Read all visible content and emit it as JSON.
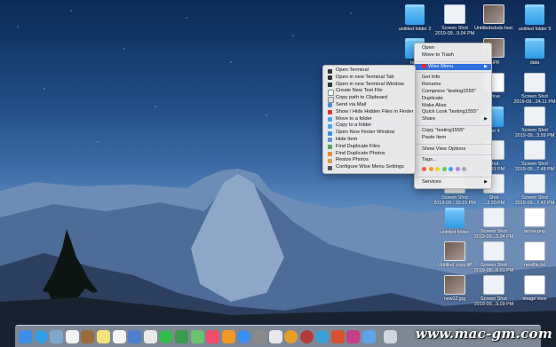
{
  "desktop_icons": [
    {
      "label": "untitled folder 2",
      "kind": "folder"
    },
    {
      "label": "Screen Shot\n2019-09...9.04 PM",
      "kind": "shot"
    },
    {
      "label": "Untitledsdsds.heic",
      "kind": "img"
    },
    {
      "label": "untitled folder 5",
      "kind": "folder"
    },
    {
      "label": "testi",
      "kind": "folder"
    },
    {
      "label": "d.jpg",
      "kind": "img"
    },
    {
      "label": "data",
      "kind": "folder"
    },
    {
      "label": "rchive",
      "kind": "doc"
    },
    {
      "label": "Screen Shot\n2019-09...24.11 PM",
      "kind": "shot"
    },
    {
      "label": "lder 4",
      "kind": "folder"
    },
    {
      "label": "Screen Shot\n2019-09...3.59 PM",
      "kind": "shot"
    },
    {
      "label": "Shot\n...3.31 PM",
      "kind": "shot"
    },
    {
      "label": "Screen Shot\n2019-09...7.48 PM",
      "kind": "shot"
    },
    {
      "label": "Screen Shot\n2019-09...10.15 PM",
      "kind": "shot"
    },
    {
      "label": "Shot\n...3.20 PM",
      "kind": "shot"
    },
    {
      "label": "Screen Shot\n2019-09...7.42 PM",
      "kind": "shot"
    },
    {
      "label": "untitled folder",
      "kind": "folder"
    },
    {
      "label": "Screen Shot\n2019-09...3.04 PM",
      "kind": "shot"
    },
    {
      "label": "arrow.png",
      "kind": "doc"
    },
    {
      "label": "Untitled copy.tiff",
      "kind": "img"
    },
    {
      "label": "Screen Shot\n2019-09...8.01 PM",
      "kind": "shot"
    },
    {
      "label": "newfile.txt",
      "kind": "doc"
    },
    {
      "label": "new12.jpg",
      "kind": "img"
    },
    {
      "label": "Screen Shot\n2019-09...9.09 PM",
      "kind": "shot"
    },
    {
      "label": "image view",
      "kind": "doc"
    }
  ],
  "main_menu": {
    "top": [
      {
        "label": "Open"
      },
      {
        "label": "Move to Trash"
      }
    ],
    "wise_menu": {
      "label": "Wise Menu"
    },
    "group2": [
      {
        "label": "Get Info"
      },
      {
        "label": "Rename"
      },
      {
        "label": "Compress \"testing1555\""
      },
      {
        "label": "Duplicate"
      },
      {
        "label": "Make Alias"
      },
      {
        "label": "Quick Look \"testing1555\""
      },
      {
        "label": "Share"
      }
    ],
    "group3": [
      {
        "label": "Copy \"testing1555\""
      },
      {
        "label": "Paste Item"
      }
    ],
    "group4": [
      {
        "label": "Show View Options"
      }
    ],
    "tags_label": "Tags...",
    "tag_colors": [
      "#ef5a4a",
      "#f49a34",
      "#f2d232",
      "#5cc85a",
      "#39a4f0",
      "#b07fe0",
      "#a9a9a9"
    ],
    "services": {
      "label": "Services"
    }
  },
  "wise_submenu": [
    {
      "label": "Open Terminal",
      "icon": "terminal-icon",
      "color": "#333"
    },
    {
      "label": "Open in new Terminal Tab",
      "icon": "terminal-icon",
      "color": "#333"
    },
    {
      "label": "Open in new Terminal Window",
      "icon": "terminal-icon",
      "color": "#333"
    },
    {
      "label": "Create New Text File",
      "icon": "document-icon",
      "color": "#fff"
    },
    {
      "label": "Copy path to Clipboard",
      "icon": "clipboard-icon",
      "color": "#ddd"
    },
    {
      "label": "Send via Mail",
      "icon": "mail-icon",
      "color": "#4a90e2"
    },
    {
      "label": "Show / Hide Hidden Files in Finder",
      "icon": "eye-icon",
      "color": "#d33"
    },
    {
      "label": "Move to a folder",
      "icon": "folder-icon",
      "color": "#4aa8f0"
    },
    {
      "label": "Copy to a folder",
      "icon": "folder-icon",
      "color": "#4aa8f0"
    },
    {
      "label": "Open New Finder Window",
      "icon": "finder-icon",
      "color": "#3c8ee8"
    },
    {
      "label": "Hide Item",
      "icon": "hide-icon",
      "color": "#6b8fd6"
    },
    {
      "label": "Find Duplicate Files",
      "icon": "duplicate-icon",
      "color": "#5a5"
    },
    {
      "label": "Find Duplicate Photos",
      "icon": "photo-icon",
      "color": "#e88b3a"
    },
    {
      "label": "Resize Photos",
      "icon": "resize-icon",
      "color": "#d4a040"
    },
    {
      "label": "Configure Wise Menu Settings",
      "icon": "gear-icon",
      "color": "#555"
    }
  ],
  "dock_apps": [
    {
      "name": "finder",
      "color": "#3b8fe6"
    },
    {
      "name": "safari",
      "color": "#2f9ee8"
    },
    {
      "name": "preview",
      "color": "#7fa7cc"
    },
    {
      "name": "calendar",
      "color": "#f3f3f3"
    },
    {
      "name": "notes-brown",
      "color": "#9a6b3a"
    },
    {
      "name": "notes",
      "color": "#f6e27a"
    },
    {
      "name": "reminders",
      "color": "#f4f4f4"
    },
    {
      "name": "keynote",
      "color": "#4d7fd0"
    },
    {
      "name": "photos",
      "color": "#e9e9e9"
    },
    {
      "name": "messages",
      "color": "#2fbf4a"
    },
    {
      "name": "facetime",
      "color": "#3a9c4a"
    },
    {
      "name": "maps",
      "color": "#6cc36c"
    },
    {
      "name": "music",
      "color": "#f24c6c"
    },
    {
      "name": "books",
      "color": "#f29a27"
    },
    {
      "name": "app-store",
      "color": "#3b8ff0"
    },
    {
      "name": "system-preferences",
      "color": "#8a8a8a"
    },
    {
      "name": "textedit",
      "color": "#e8e8e8"
    },
    {
      "name": "chrome",
      "color": "#e6a023"
    },
    {
      "name": "compass",
      "color": "#b23b3b"
    },
    {
      "name": "pinwheel",
      "color": "#3aa0d8"
    },
    {
      "name": "maker",
      "color": "#d84f2f"
    },
    {
      "name": "stack",
      "color": "#c63b8a"
    },
    {
      "name": "downloads",
      "color": "#5fa3e8"
    },
    {
      "name": "trash",
      "color": "#cfd6de"
    }
  ],
  "watermark": "www.mac-gm.com"
}
